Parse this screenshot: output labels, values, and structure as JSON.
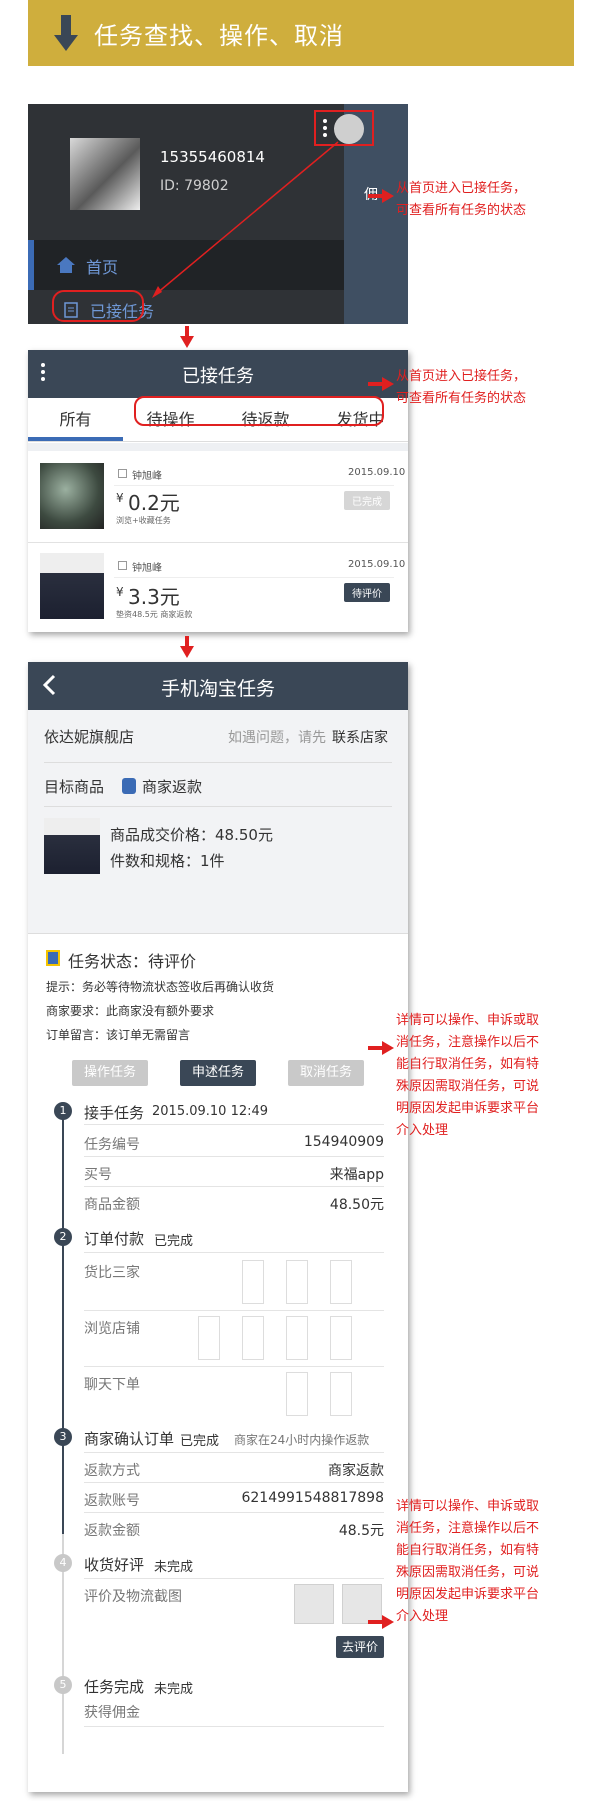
{
  "banner": {
    "title": "任务查找、操作、取消",
    "color": "#cfae3d"
  },
  "notes": {
    "n1": [
      "从首页进入已接任务，",
      "可查看所有任务的状态"
    ],
    "n2": [
      "从首页进入已接任务，",
      "可查看所有任务的状态"
    ],
    "n3": [
      "详情可以操作、申诉或取",
      "消任务，注意操作以后不",
      "能自行取消任务，如有特",
      "殊原因需取消任务，可说",
      "明原因发起申诉要求平台",
      "介入处理"
    ],
    "n4": [
      "详情可以操作、申诉或取",
      "消任务，注意操作以后不",
      "能自行取消任务，如有特",
      "殊原因需取消任务，可说",
      "明原因发起申诉要求平台",
      "介入处理"
    ]
  },
  "drawer": {
    "phone": "15355460814",
    "user_id": "ID: 79802",
    "home": "首页",
    "accepted": "已接任务",
    "side_text": "佣"
  },
  "accepted_screen": {
    "title": "已接任务",
    "tabs": [
      "所有",
      "待操作",
      "待返款",
      "发货中"
    ],
    "orders": [
      {
        "name": "钟旭峰",
        "date": "2015.09.10",
        "price": "0.2元",
        "currency": "¥",
        "desc": "浏览+收藏任务",
        "status": "已完成"
      },
      {
        "name": "钟旭峰",
        "date": "2015.09.10",
        "price": "3.3元",
        "currency": "¥",
        "desc": "垫资48.5元 商家返款",
        "status": "待评价"
      }
    ]
  },
  "detail": {
    "title": "手机淘宝任务",
    "shop": "依达妮旗舰店",
    "contact_prefix": "如遇问题，请先",
    "contact_link": "联系店家",
    "target_label": "目标商品",
    "refund_type": "商家返款",
    "deal_price": "商品成交价格：48.50元",
    "spec": "件数和规格：1件",
    "status": "任务状态：待评价",
    "tip": "提示：务必等待物流状态签收后再确认收货",
    "merchant_req": "商家要求：此商家没有额外要求",
    "order_msg": "订单留言：该订单无需留言",
    "buttons": [
      "操作任务",
      "申述任务",
      "取消任务"
    ],
    "steps": {
      "s1": {
        "num": "1",
        "title": "接手任务",
        "time": "2015.09.10 12:49",
        "rows": [
          [
            "任务编号",
            "154940909"
          ],
          [
            "买号",
            "来福app"
          ],
          [
            "商品金额",
            "48.50元"
          ]
        ]
      },
      "s2": {
        "num": "2",
        "title": "订单付款",
        "state": "已完成",
        "groups": [
          "货比三家",
          "浏览店铺",
          "聊天下单"
        ]
      },
      "s3": {
        "num": "3",
        "title": "商家确认订单",
        "state": "已完成",
        "extra": "商家在24小时内操作返款",
        "rows": [
          [
            "返款方式",
            "商家返款"
          ],
          [
            "返款账号",
            "6214991548817898"
          ],
          [
            "返款金额",
            "48.5元"
          ]
        ]
      },
      "s4": {
        "num": "4",
        "title": "收货好评",
        "state": "未完成",
        "upload_label": "评价及物流截图",
        "button": "去评价"
      },
      "s5": {
        "num": "5",
        "title": "任务完成",
        "state": "未完成",
        "sub": "获得佣金"
      }
    }
  }
}
